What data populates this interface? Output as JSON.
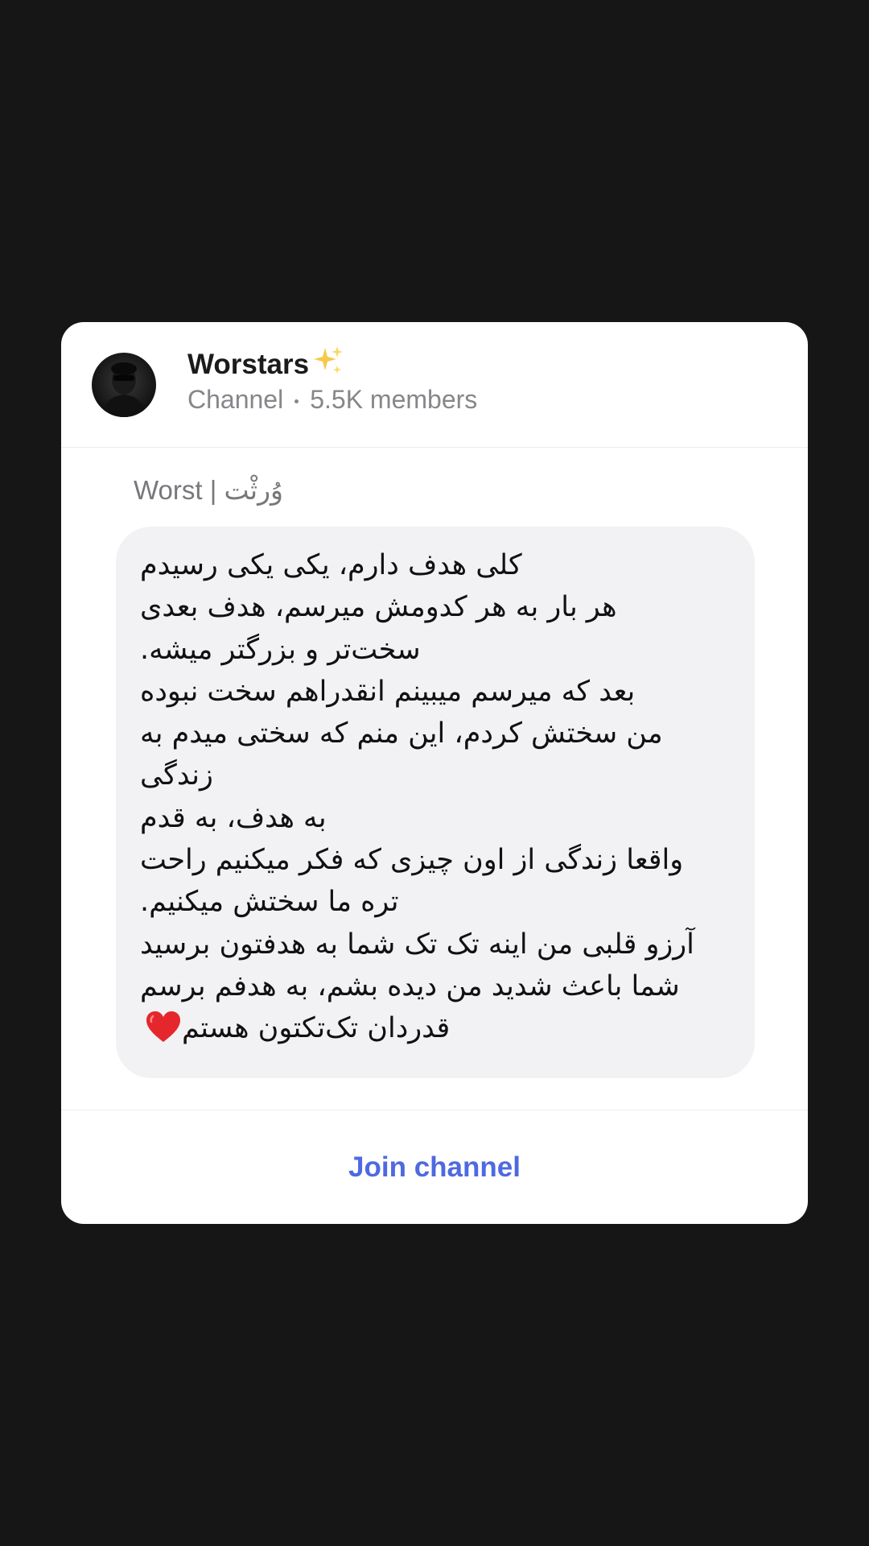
{
  "channel": {
    "name": "Worstars",
    "type": "Channel",
    "members": "5.5K members"
  },
  "post": {
    "sender": "Worst | وُرثْت",
    "lines": [
      "کلی هدف دارم، یکی یکی رسیدم",
      "هر بار به هر کدومش میرسم، هدف بعدی",
      "سخت‌تر و بزرگتر میشه.",
      "بعد که میرسم میبینم انقدراهم سخت نبوده",
      "من سختش کردم، این منم که سختی میدم به",
      "زندگی",
      "به هدف، به قدم",
      "واقعا زندگی از اون چیزی که فکر میکنیم راحت",
      "تره ما سختش میکنیم.",
      "آرزو قلبی من اینه تک تک شما به هدفتون برسید",
      "شما باعث شدید من دیده بشم، به هدفم برسم",
      "قدردان تک‌تکتون هستم"
    ]
  },
  "actions": {
    "join_label": "Join channel"
  },
  "colors": {
    "background": "#161617",
    "card": "#ffffff",
    "bubble": "#f2f2f5",
    "accent": "#4f69e0",
    "muted": "#86868b"
  },
  "icons": {
    "title_emoji": "sparkles-icon",
    "end_emoji": "red-heart-icon"
  }
}
